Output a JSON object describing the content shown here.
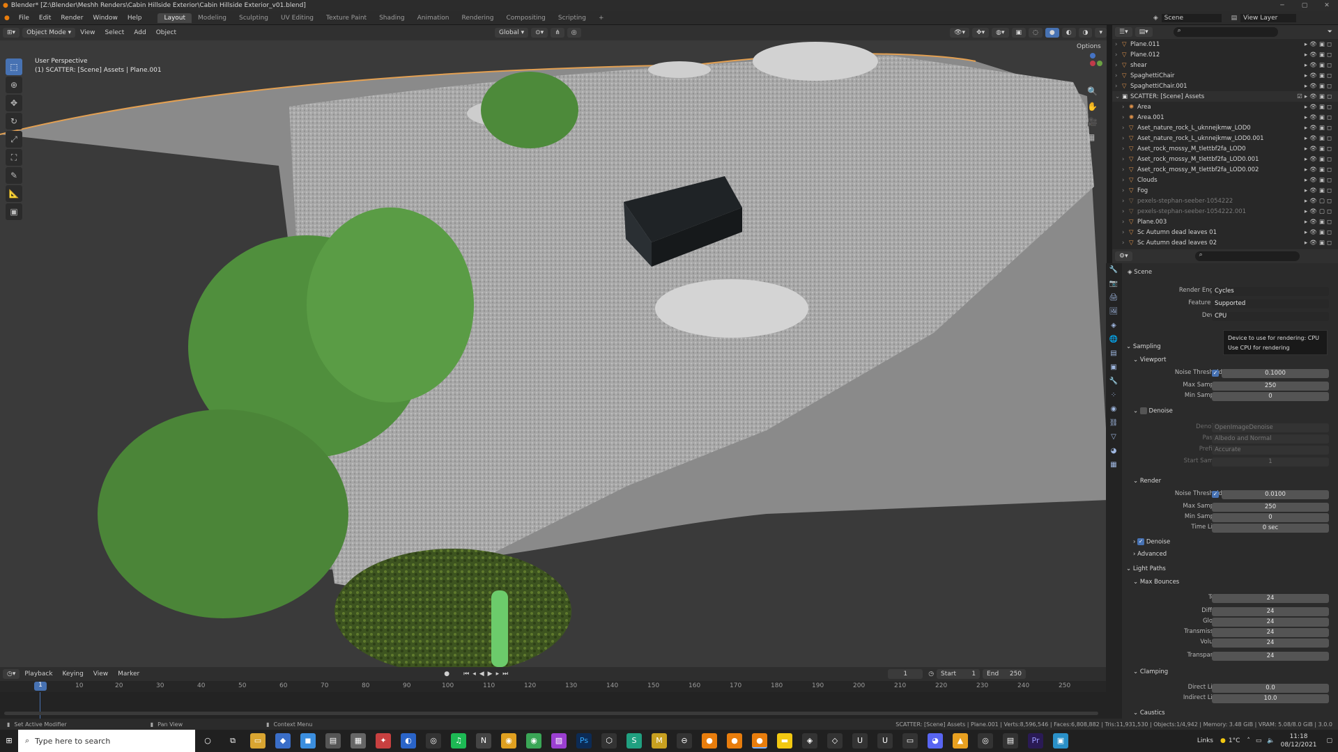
{
  "window_title": "Blender* [Z:\\Blender\\Meshh Renders\\Cabin Hillside Exterior\\Cabin Hillside Exterior_v01.blend]",
  "menu": [
    "File",
    "Edit",
    "Render",
    "Window",
    "Help"
  ],
  "workspaces": [
    "Layout",
    "Modeling",
    "Sculpting",
    "UV Editing",
    "Texture Paint",
    "Shading",
    "Animation",
    "Rendering",
    "Compositing",
    "Scripting"
  ],
  "active_workspace": "Layout",
  "scene_name": "Scene",
  "view_layer": "View Layer",
  "viewport_header": {
    "mode": "Object Mode",
    "menus": [
      "View",
      "Select",
      "Add",
      "Object"
    ],
    "transform_orientation": "Global",
    "options": "Options"
  },
  "viewport_overlay": {
    "perspective": "User Perspective",
    "context": "(1) SCATTER: [Scene] Assets | Plane.001"
  },
  "outliner": {
    "rows": [
      {
        "label": "Plane.011",
        "kind": "object"
      },
      {
        "label": "Plane.012",
        "kind": "object"
      },
      {
        "label": "shear",
        "kind": "object"
      },
      {
        "label": "SpaghettiChair",
        "kind": "object"
      },
      {
        "label": "SpaghettiChair.001",
        "kind": "object"
      },
      {
        "label": "SCATTER: [Scene] Assets",
        "kind": "collection"
      },
      {
        "label": "Area",
        "kind": "object"
      },
      {
        "label": "Area.001",
        "kind": "object"
      },
      {
        "label": "Aset_nature_rock_L_uknnejkmw_LOD0",
        "kind": "object"
      },
      {
        "label": "Aset_nature_rock_L_uknnejkmw_LOD0.001",
        "kind": "object"
      },
      {
        "label": "Aset_rock_mossy_M_tlettbf2fa_LOD0",
        "kind": "object"
      },
      {
        "label": "Aset_rock_mossy_M_tlettbf2fa_LOD0.001",
        "kind": "object"
      },
      {
        "label": "Aset_rock_mossy_M_tlettbf2fa_LOD0.002",
        "kind": "object"
      },
      {
        "label": "Clouds",
        "kind": "object"
      },
      {
        "label": "Fog",
        "kind": "object"
      },
      {
        "label": "pexels-stephan-seeber-1054222",
        "kind": "dim"
      },
      {
        "label": "pexels-stephan-seeber-1054222.001",
        "kind": "dim"
      },
      {
        "label": "Plane.003",
        "kind": "object"
      },
      {
        "label": "Sc Autumn dead leaves 01",
        "kind": "object"
      },
      {
        "label": "Sc Autumn dead leaves 02",
        "kind": "object"
      }
    ]
  },
  "properties": {
    "context": "Scene",
    "render_engine_label": "Render Engine",
    "render_engine": "Cycles",
    "feature_set_label": "Feature Set",
    "feature_set": "Supported",
    "device_label": "Device",
    "device": "CPU",
    "tooltip_line1": "Device to use for rendering: CPU",
    "tooltip_line2": "Use CPU for rendering",
    "sampling": "Sampling",
    "viewport": "Viewport",
    "noise_threshold_label": "Noise Threshold",
    "vp_noise_threshold": "0.1000",
    "max_samples_label": "Max Samples",
    "vp_max_samples": "250",
    "min_samples_label": "Min Samples",
    "vp_min_samples": "0",
    "denoise": "Denoise",
    "denoiser_label": "Denoiser",
    "denoiser": "OpenImageDenoise",
    "passes_label": "Passes",
    "passes": "Albedo and Normal",
    "prefilter_label": "Prefilter",
    "prefilter": "Accurate",
    "start_sample_label": "Start Sample",
    "start_sample": "1",
    "render": "Render",
    "r_noise_threshold": "0.0100",
    "r_max_samples": "250",
    "r_min_samples": "0",
    "time_limit_label": "Time Limit",
    "time_limit": "0 sec",
    "advanced": "Advanced",
    "light_paths": "Light Paths",
    "max_bounces": "Max Bounces",
    "total_label": "Total",
    "total": "24",
    "diffuse_label": "Diffuse",
    "diffuse": "24",
    "glossy_label": "Glossy",
    "glossy": "24",
    "transmission_label": "Transmission",
    "transmission": "24",
    "volume_label": "Volume",
    "volume": "24",
    "transparent_label": "Transparent",
    "transparent": "24",
    "clamping": "Clamping",
    "direct_light_label": "Direct Light",
    "direct_light": "0.0",
    "indirect_light_label": "Indirect Light",
    "indirect_light": "10.0",
    "caustics": "Caustics"
  },
  "timeline": {
    "menus": [
      "Playback",
      "Keying",
      "View",
      "Marker"
    ],
    "current_frame": "1",
    "start_label": "Start",
    "start": "1",
    "end_label": "End",
    "end": "250",
    "ticks": [
      "1",
      "10",
      "20",
      "30",
      "40",
      "50",
      "60",
      "70",
      "80",
      "90",
      "100",
      "110",
      "120",
      "130",
      "140",
      "150",
      "160",
      "170",
      "180",
      "190",
      "200",
      "210",
      "220",
      "230",
      "240",
      "250"
    ]
  },
  "statusbar": {
    "left1": "Set Active Modifier",
    "left2": "Pan View",
    "left3": "Context Menu",
    "right": "SCATTER: [Scene] Assets | Plane.001 | Verts:8,596,546 | Faces:6,808,882 | Tris:11,931,530 | Objects:1/4,942 | Memory: 3.48 GiB | VRAM: 5.08/8.0 GiB | 3.0.0"
  },
  "taskbar": {
    "search_placeholder": "Type here to search",
    "links": "Links",
    "temp": "1°C",
    "time": "11:18",
    "date": "08/12/2021"
  }
}
